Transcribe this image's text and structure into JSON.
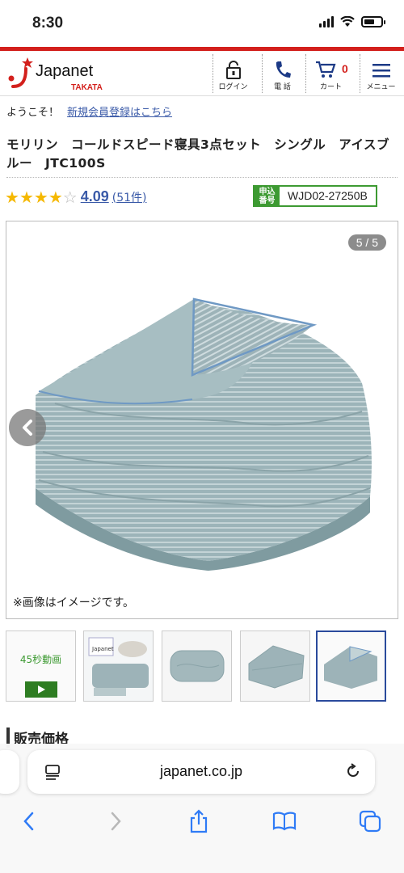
{
  "status_bar": {
    "time": "8:30"
  },
  "header": {
    "logo_text": "Japanet",
    "logo_sub": "TAKATA",
    "nav": [
      {
        "label": "ログイン",
        "icon": "lock-icon"
      },
      {
        "label": "電 話",
        "icon": "phone-icon"
      },
      {
        "label": "カート",
        "icon": "cart-icon",
        "count": "0"
      },
      {
        "label": "メニュー",
        "icon": "menu-icon"
      }
    ]
  },
  "welcome": {
    "greeting": "ようこそ！",
    "register_link": "新規会員登録はこちら"
  },
  "product": {
    "title": "モリリン　コールドスピード寝具3点セット　シングル　アイスブルー　JTC100S",
    "rating_value": "4.09",
    "rating_stars": 4,
    "rating_count": "(51件)",
    "order_tag": "申込番号",
    "order_code": "WJD02-27250B"
  },
  "gallery": {
    "slide_counter": "5 / 5",
    "disclaimer": "※画像はイメージです。",
    "thumb_video_label": "45秒動画",
    "thumb_pillow_text": "Japanet",
    "accent_color": "#2a4a9c"
  },
  "section": {
    "price_heading": "販売価格"
  },
  "browser": {
    "url": "japanet.co.jp"
  },
  "colors": {
    "brand_red": "#d3201c",
    "link_blue": "#3a5aa8",
    "green": "#3d9a32",
    "star": "#f5b800"
  }
}
